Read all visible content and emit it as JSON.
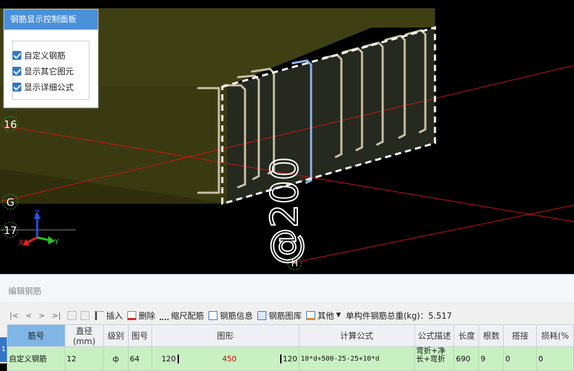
{
  "viewport": {
    "axis_labels": {
      "row_16": "16",
      "row_g": "G",
      "row_17": "17",
      "col_h": "H"
    },
    "dimension_text": "@200",
    "axis_gizmo": {
      "x": "X",
      "y": "Y",
      "z": "Z"
    }
  },
  "control_panel": {
    "title": "钢筋显示控制面板",
    "options": [
      {
        "label": "自定义钢筋",
        "checked": true
      },
      {
        "label": "显示其它图元",
        "checked": true
      },
      {
        "label": "显示详细公式",
        "checked": true
      }
    ]
  },
  "editor": {
    "title": "编辑钢筋",
    "nav": [
      "|<",
      "<",
      ">",
      ">|"
    ],
    "toolbar": {
      "insert": "插入",
      "delete": "删除",
      "scale": "缩尺配筋",
      "info": "钢筋信息",
      "library": "钢筋图库",
      "other": "其他",
      "total_weight": "单构件钢筋总重(kg)：5.517"
    },
    "columns": [
      "筋号",
      "直径(mm)",
      "级别",
      "图号",
      "图形",
      "计算公式",
      "公式描述",
      "长度",
      "根数",
      "搭接",
      "损耗(%"
    ],
    "rows": [
      {
        "index": "1",
        "name": "自定义钢筋",
        "diameter": "12",
        "grade": "ф",
        "figure_no": "64",
        "shape_left": "120",
        "shape_mid": "450",
        "shape_right": "120",
        "formula": "10*d+500-25-25+10*d",
        "description": "弯折+净长+弯折",
        "length": "690",
        "count": "9",
        "lap": "0",
        "loss": "0"
      }
    ]
  },
  "colors": {
    "panel_title_bg": "#4a90d9",
    "beam_fill": "#3d3d12",
    "grid_line": "#e01010",
    "row_highlight": "#c9f0c3",
    "selected_rebar": "#8fb6f0"
  }
}
